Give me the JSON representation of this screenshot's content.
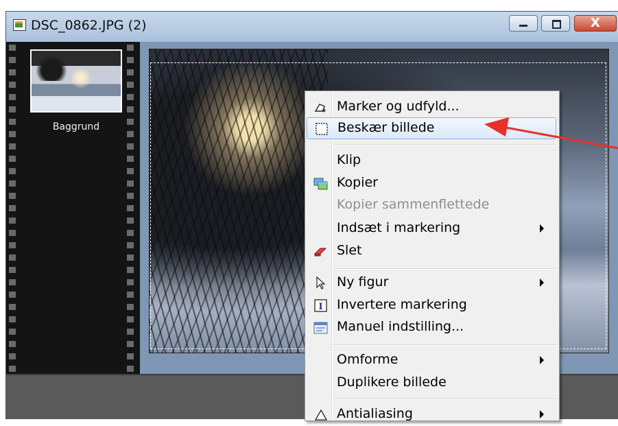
{
  "window": {
    "title": "DSC_0862.JPG (2)",
    "controls": {
      "minimize": "_",
      "maximize": "□",
      "close": "X"
    }
  },
  "layers": {
    "items": [
      {
        "label": "Baggrund"
      }
    ]
  },
  "context_menu": {
    "items": [
      {
        "label": "Marker og udfyld...",
        "icon": "lasso-fill-icon",
        "enabled": true
      },
      {
        "label": "Beskær billede",
        "icon": "crop-selection-icon",
        "enabled": true,
        "highlighted": true
      },
      {
        "label": "Klip",
        "enabled": true
      },
      {
        "label": "Kopier",
        "icon": "copy-image-icon",
        "enabled": true
      },
      {
        "label": "Kopier sammenflettede",
        "enabled": false
      },
      {
        "label": "Indsæt i markering",
        "enabled": true,
        "submenu": true
      },
      {
        "label": "Slet",
        "icon": "eraser-icon",
        "enabled": true
      },
      {
        "label": "Ny figur",
        "icon": "pointer-icon",
        "enabled": true,
        "submenu": true
      },
      {
        "label": "Invertere markering",
        "icon": "invert-selection-icon",
        "enabled": true
      },
      {
        "label": "Manuel indstilling...",
        "icon": "manual-settings-icon",
        "enabled": true
      },
      {
        "label": "Omforme",
        "enabled": true,
        "submenu": true
      },
      {
        "label": "Duplikere billede",
        "enabled": true
      },
      {
        "label": "Antialiasing",
        "icon": "antialias-icon",
        "enabled": true,
        "submenu": true
      }
    ]
  },
  "colors": {
    "annotation_arrow": "#e8302a",
    "highlight": "#dbe9f9",
    "disabled_text": "#8f8f8f"
  }
}
